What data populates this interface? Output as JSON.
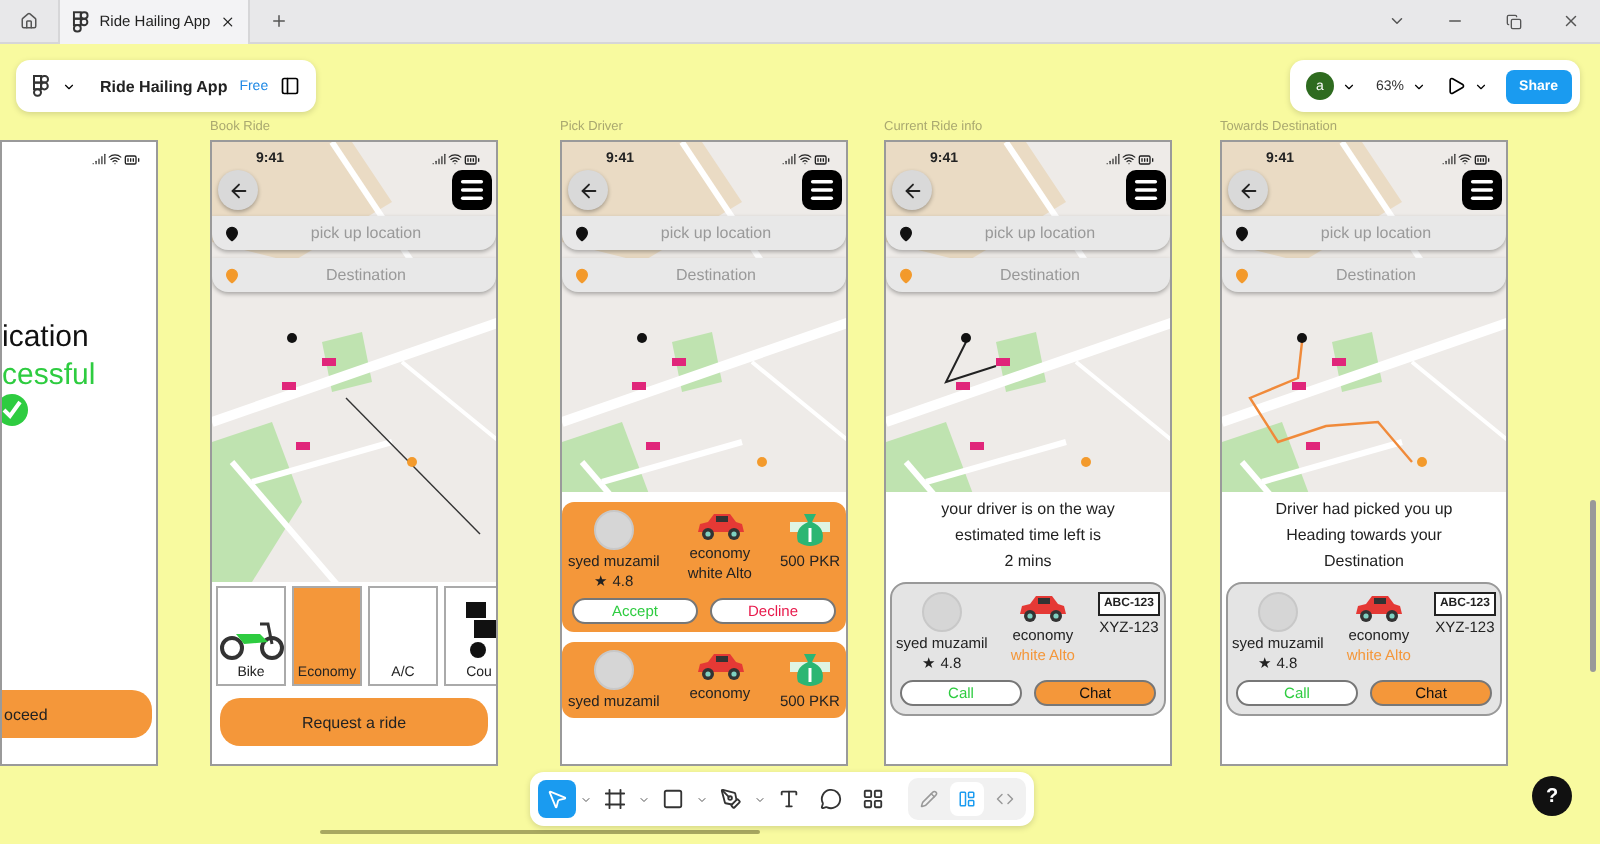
{
  "browser": {
    "tabs": [
      {
        "label": "Ride Hailing App",
        "selected": true
      }
    ]
  },
  "file_bar": {
    "file_name": "Ride Hailing App",
    "plan": "Free"
  },
  "share_bar": {
    "avatar": "a",
    "zoom": "63%",
    "share": "Share"
  },
  "frames": [
    {
      "kind": "success_partial",
      "lines": [
        "ication",
        "cessful"
      ],
      "button": "oceed"
    },
    {
      "kind": "book_ride",
      "label": "Book Ride",
      "time": "9:41",
      "pickup": "pick up location",
      "destination": "Destination",
      "map": {
        "kind": "straight"
      },
      "vehicles": [
        {
          "kind": "bike",
          "label": "Bike",
          "selected": false
        },
        {
          "kind": "plain",
          "label": "Economy",
          "selected": true
        },
        {
          "kind": "plain",
          "label": "A/C",
          "selected": false
        },
        {
          "kind": "courier",
          "label": "Cou",
          "selected": false
        }
      ],
      "button": "Request a ride"
    },
    {
      "kind": "driver_offers",
      "label": "Pick Driver",
      "time": "9:41",
      "pickup": "pick up location",
      "destination": "Destination",
      "map": {
        "kind": "plain"
      },
      "offers": [
        {
          "name": "syed muzamil",
          "rating": "★ 4.8",
          "car": "economy",
          "car_detail": "white Alto",
          "price": "500 PKR",
          "accept": "Accept",
          "decline": "Decline"
        },
        {
          "name": "syed muzamil",
          "car": "economy",
          "price": "500 PKR"
        }
      ]
    },
    {
      "kind": "ride_status",
      "label": "Current Ride info",
      "time": "9:41",
      "pickup": "pick up location",
      "destination": "Destination",
      "map": {
        "kind": "short"
      },
      "message": [
        "your driver is on the way",
        "estimated time left is",
        "2 mins"
      ],
      "driver": {
        "name": "syed muzamil",
        "rating": "★ 4.8",
        "car": "economy",
        "car_detail": "white Alto",
        "plate_sign": "ABC-123",
        "plate": "XYZ-123",
        "call": "Call",
        "chat": "Chat"
      }
    },
    {
      "kind": "ride_status",
      "label": "Towards Destination",
      "time": "9:41",
      "pickup": "pick up location",
      "destination": "Destination",
      "map": {
        "kind": "curved"
      },
      "message": [
        "Driver had picked you up",
        "Heading towards your",
        "Destination"
      ],
      "driver": {
        "name": "syed muzamil",
        "rating": "★ 4.8",
        "car": "economy",
        "car_detail": "white Alto",
        "plate_sign": "ABC-123",
        "plate": "XYZ-123",
        "call": "Call",
        "chat": "Chat"
      }
    }
  ],
  "tools": [
    {
      "kind": "move",
      "selected": true,
      "menu": true
    },
    {
      "kind": "frame",
      "selected": false,
      "menu": true
    },
    {
      "kind": "shape",
      "selected": false,
      "menu": true
    },
    {
      "kind": "pen",
      "selected": false,
      "menu": true
    },
    {
      "kind": "text",
      "selected": false,
      "menu": false
    },
    {
      "kind": "comment",
      "selected": false,
      "menu": false
    },
    {
      "kind": "actions",
      "selected": false,
      "menu": false
    }
  ],
  "modes": [
    {
      "kind": "draw",
      "selected": false
    },
    {
      "kind": "design",
      "selected": true
    },
    {
      "kind": "dev",
      "selected": false
    }
  ],
  "help": "?"
}
